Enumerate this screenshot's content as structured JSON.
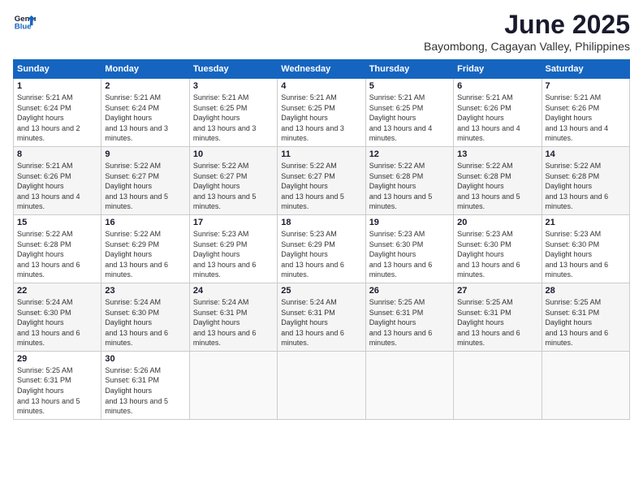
{
  "logo": {
    "text_general": "General",
    "text_blue": "Blue"
  },
  "title": "June 2025",
  "subtitle": "Bayombong, Cagayan Valley, Philippines",
  "header": {
    "days": [
      "Sunday",
      "Monday",
      "Tuesday",
      "Wednesday",
      "Thursday",
      "Friday",
      "Saturday"
    ]
  },
  "weeks": [
    [
      {
        "day": "1",
        "sunrise": "5:21 AM",
        "sunset": "6:24 PM",
        "daylight": "13 hours and 2 minutes."
      },
      {
        "day": "2",
        "sunrise": "5:21 AM",
        "sunset": "6:24 PM",
        "daylight": "13 hours and 3 minutes."
      },
      {
        "day": "3",
        "sunrise": "5:21 AM",
        "sunset": "6:25 PM",
        "daylight": "13 hours and 3 minutes."
      },
      {
        "day": "4",
        "sunrise": "5:21 AM",
        "sunset": "6:25 PM",
        "daylight": "13 hours and 3 minutes."
      },
      {
        "day": "5",
        "sunrise": "5:21 AM",
        "sunset": "6:25 PM",
        "daylight": "13 hours and 4 minutes."
      },
      {
        "day": "6",
        "sunrise": "5:21 AM",
        "sunset": "6:26 PM",
        "daylight": "13 hours and 4 minutes."
      },
      {
        "day": "7",
        "sunrise": "5:21 AM",
        "sunset": "6:26 PM",
        "daylight": "13 hours and 4 minutes."
      }
    ],
    [
      {
        "day": "8",
        "sunrise": "5:21 AM",
        "sunset": "6:26 PM",
        "daylight": "13 hours and 4 minutes."
      },
      {
        "day": "9",
        "sunrise": "5:22 AM",
        "sunset": "6:27 PM",
        "daylight": "13 hours and 5 minutes."
      },
      {
        "day": "10",
        "sunrise": "5:22 AM",
        "sunset": "6:27 PM",
        "daylight": "13 hours and 5 minutes."
      },
      {
        "day": "11",
        "sunrise": "5:22 AM",
        "sunset": "6:27 PM",
        "daylight": "13 hours and 5 minutes."
      },
      {
        "day": "12",
        "sunrise": "5:22 AM",
        "sunset": "6:28 PM",
        "daylight": "13 hours and 5 minutes."
      },
      {
        "day": "13",
        "sunrise": "5:22 AM",
        "sunset": "6:28 PM",
        "daylight": "13 hours and 5 minutes."
      },
      {
        "day": "14",
        "sunrise": "5:22 AM",
        "sunset": "6:28 PM",
        "daylight": "13 hours and 6 minutes."
      }
    ],
    [
      {
        "day": "15",
        "sunrise": "5:22 AM",
        "sunset": "6:28 PM",
        "daylight": "13 hours and 6 minutes."
      },
      {
        "day": "16",
        "sunrise": "5:22 AM",
        "sunset": "6:29 PM",
        "daylight": "13 hours and 6 minutes."
      },
      {
        "day": "17",
        "sunrise": "5:23 AM",
        "sunset": "6:29 PM",
        "daylight": "13 hours and 6 minutes."
      },
      {
        "day": "18",
        "sunrise": "5:23 AM",
        "sunset": "6:29 PM",
        "daylight": "13 hours and 6 minutes."
      },
      {
        "day": "19",
        "sunrise": "5:23 AM",
        "sunset": "6:30 PM",
        "daylight": "13 hours and 6 minutes."
      },
      {
        "day": "20",
        "sunrise": "5:23 AM",
        "sunset": "6:30 PM",
        "daylight": "13 hours and 6 minutes."
      },
      {
        "day": "21",
        "sunrise": "5:23 AM",
        "sunset": "6:30 PM",
        "daylight": "13 hours and 6 minutes."
      }
    ],
    [
      {
        "day": "22",
        "sunrise": "5:24 AM",
        "sunset": "6:30 PM",
        "daylight": "13 hours and 6 minutes."
      },
      {
        "day": "23",
        "sunrise": "5:24 AM",
        "sunset": "6:30 PM",
        "daylight": "13 hours and 6 minutes."
      },
      {
        "day": "24",
        "sunrise": "5:24 AM",
        "sunset": "6:31 PM",
        "daylight": "13 hours and 6 minutes."
      },
      {
        "day": "25",
        "sunrise": "5:24 AM",
        "sunset": "6:31 PM",
        "daylight": "13 hours and 6 minutes."
      },
      {
        "day": "26",
        "sunrise": "5:25 AM",
        "sunset": "6:31 PM",
        "daylight": "13 hours and 6 minutes."
      },
      {
        "day": "27",
        "sunrise": "5:25 AM",
        "sunset": "6:31 PM",
        "daylight": "13 hours and 6 minutes."
      },
      {
        "day": "28",
        "sunrise": "5:25 AM",
        "sunset": "6:31 PM",
        "daylight": "13 hours and 6 minutes."
      }
    ],
    [
      {
        "day": "29",
        "sunrise": "5:25 AM",
        "sunset": "6:31 PM",
        "daylight": "13 hours and 5 minutes."
      },
      {
        "day": "30",
        "sunrise": "5:26 AM",
        "sunset": "6:31 PM",
        "daylight": "13 hours and 5 minutes."
      },
      null,
      null,
      null,
      null,
      null
    ]
  ]
}
